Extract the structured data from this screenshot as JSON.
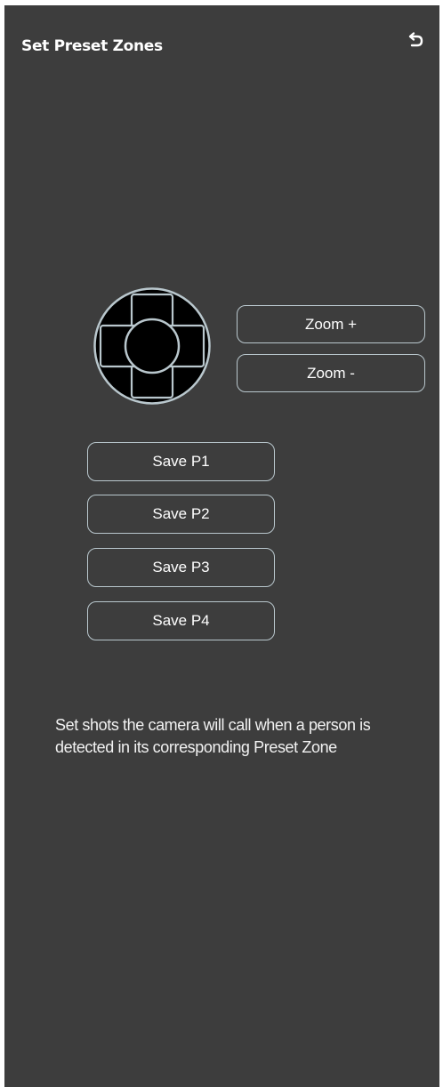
{
  "header": {
    "title": "Set Preset Zones",
    "back_icon": "undo-arrow-icon"
  },
  "camera_control": {
    "joystick_icon": "dpad-joystick-icon",
    "zoom_in_label": "Zoom +",
    "zoom_out_label": "Zoom -"
  },
  "presets": [
    {
      "label": "Save P1"
    },
    {
      "label": "Save P2"
    },
    {
      "label": "Save P3"
    },
    {
      "label": "Save P4"
    }
  ],
  "description": "Set shots the camera will call when a person is detected in its corresponding Preset Zone",
  "colors": {
    "background": "#3d3d3d",
    "outline": "#b9c7cd",
    "text": "#ffffff"
  }
}
